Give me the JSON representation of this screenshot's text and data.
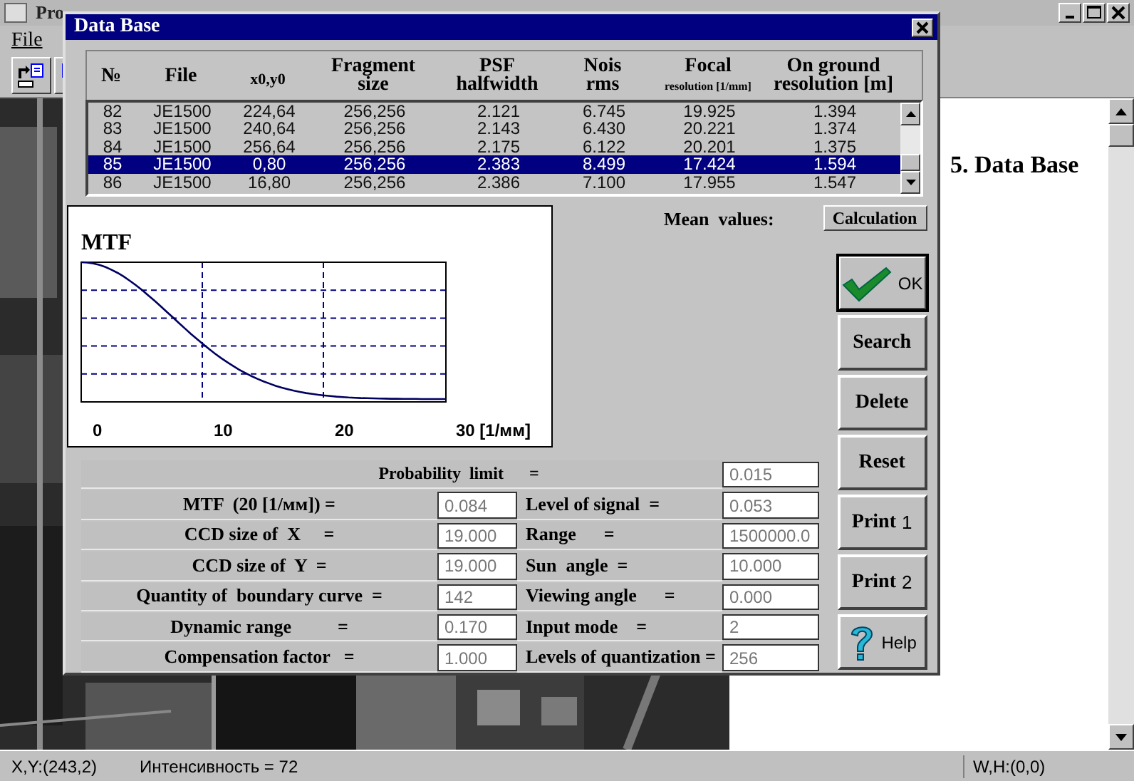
{
  "main_window": {
    "title": "Pro",
    "menu": [
      "File"
    ],
    "document": {
      "heading": "5. Data Base"
    },
    "status_bar": [
      "X,Y:(243,2)",
      "Интенсивность = 72",
      "W,H:(0,0)"
    ]
  },
  "dialog": {
    "title": "Data Base",
    "table": {
      "columns": [
        {
          "line1": "№",
          "kind": "big"
        },
        {
          "line1": "File",
          "kind": "big"
        },
        {
          "line1": "x0,y0",
          "kind": "small"
        },
        {
          "line1": "Fragment",
          "line2": "size",
          "kind": "big"
        },
        {
          "line1": "PSF",
          "line2": "halfwidth",
          "kind": "big"
        },
        {
          "line1": "Nois",
          "line2": "rms",
          "kind": "big"
        },
        {
          "line1": "Focal",
          "line2": "resolution [1/mm]",
          "kind": "tiny"
        },
        {
          "line1": "On ground",
          "line2": "resolution [m]",
          "kind": "big"
        }
      ],
      "rows": [
        {
          "cells": [
            "82",
            "JE1500",
            "224,64",
            "256,256",
            "2.121",
            "6.745",
            "19.925",
            "1.394"
          ],
          "selected": false
        },
        {
          "cells": [
            "83",
            "JE1500",
            "240,64",
            "256,256",
            "2.143",
            "6.430",
            "20.221",
            "1.374"
          ],
          "selected": false
        },
        {
          "cells": [
            "84",
            "JE1500",
            "256,64",
            "256,256",
            "2.175",
            "6.122",
            "20.201",
            "1.375"
          ],
          "selected": false
        },
        {
          "cells": [
            "85",
            "JE1500",
            "0,80",
            "256,256",
            "2.383",
            "8.499",
            "17.424",
            "1.594"
          ],
          "selected": true
        },
        {
          "cells": [
            "86",
            "JE1500",
            "16,80",
            "256,256",
            "2.386",
            "7.100",
            "17.955",
            "1.547"
          ],
          "selected": false
        }
      ]
    },
    "mtf_plot": {
      "title": "MTF",
      "x_labels": [
        "0",
        "10",
        "20",
        "30 [1/мм]"
      ]
    },
    "mean_label": "Mean  values:",
    "calculation_button": "Calculation",
    "parameters": {
      "top": {
        "label": "Probability  limit      =",
        "value": "0.015"
      },
      "rows": [
        {
          "left": {
            "label": "MTF  (20 [1/мм]) =",
            "value": "0.084"
          },
          "right": {
            "label": "Level of signal  =",
            "value": "0.053"
          }
        },
        {
          "left": {
            "label": "CCD size of  X     =",
            "value": "19.000"
          },
          "right": {
            "label": "Range      =",
            "value": "1500000.0"
          }
        },
        {
          "left": {
            "label": "CCD size of  Y  =",
            "value": "19.000"
          },
          "right": {
            "label": "Sun  angle  =",
            "value": "10.000"
          }
        },
        {
          "left": {
            "label": "Quantity of  boundary curve  =",
            "value": "142"
          },
          "right": {
            "label": "Viewing angle      =",
            "value": "0.000"
          }
        },
        {
          "left": {
            "label": "Dynamic range          =",
            "value": "0.170"
          },
          "right": {
            "label": "Input mode    =",
            "value": "2"
          }
        },
        {
          "left": {
            "label": "Compensation factor   =",
            "value": "1.000"
          },
          "right": {
            "label": "Levels of quantization =",
            "value": "256"
          }
        }
      ]
    },
    "buttons": [
      {
        "label": "OK",
        "kind": "check",
        "default": true
      },
      {
        "label": "Search",
        "kind": "text",
        "default": false
      },
      {
        "label": "Delete",
        "kind": "text",
        "default": false
      },
      {
        "label": "Reset",
        "kind": "text",
        "default": false
      },
      {
        "label": "Print",
        "number": "1",
        "kind": "numbered",
        "default": false
      },
      {
        "label": "Print",
        "number": "2",
        "kind": "numbered",
        "default": false
      },
      {
        "label": "Help",
        "kind": "help",
        "default": false
      }
    ]
  }
}
